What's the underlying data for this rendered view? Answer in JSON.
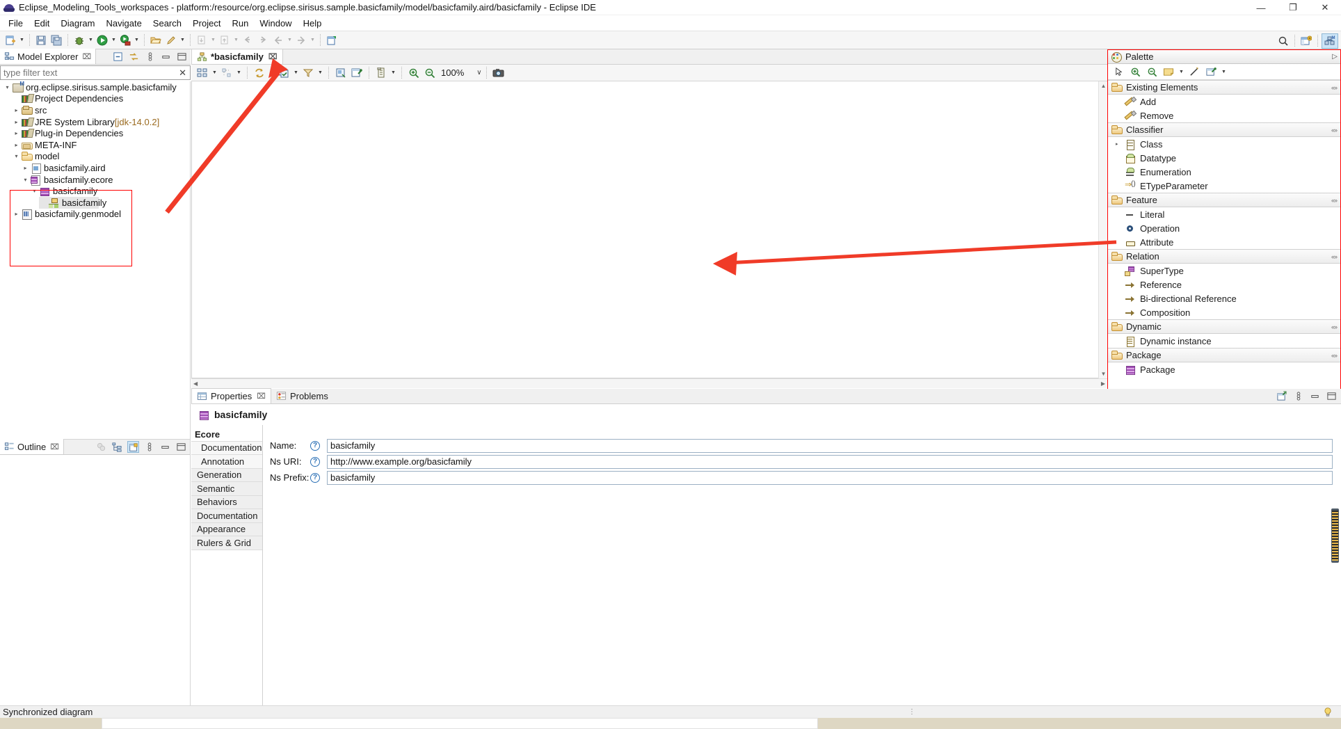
{
  "window": {
    "title": "Eclipse_Modeling_Tools_workspaces - platform:/resource/org.eclipse.sirisus.sample.basicfamily/model/basicfamily.aird/basicfamily - Eclipse IDE",
    "minimize_label": "—",
    "maximize_label": "❐",
    "close_label": "✕"
  },
  "menubar": {
    "items": [
      {
        "label": "File"
      },
      {
        "label": "Edit"
      },
      {
        "label": "Diagram"
      },
      {
        "label": "Navigate"
      },
      {
        "label": "Search"
      },
      {
        "label": "Project"
      },
      {
        "label": "Run"
      },
      {
        "label": "Window"
      },
      {
        "label": "Help"
      }
    ]
  },
  "model_explorer": {
    "tab_label": "Model Explorer",
    "close_glyph": "⌧",
    "filter_placeholder": "type filter text",
    "filter_value": "",
    "clear_glyph": "✕",
    "tools": [
      {
        "name": "collapse-all-icon"
      },
      {
        "name": "link-with-editor-icon"
      },
      {
        "name": "view-menu-icon"
      },
      {
        "name": "minimize-icon"
      },
      {
        "name": "maximize-icon"
      }
    ],
    "tree": [
      {
        "label": "org.eclipse.sirisus.sample.basicfamily",
        "indent": 0,
        "twist": "▾",
        "icon": "ic-proj",
        "selected": false,
        "dim": ""
      },
      {
        "label": "Project Dependencies",
        "indent": 1,
        "twist": "",
        "icon": "ic-lib",
        "selected": false,
        "dim": ""
      },
      {
        "label": "src",
        "indent": 1,
        "twist": "▸",
        "icon": "ic-pkgf",
        "selected": false,
        "dim": ""
      },
      {
        "label": "JRE System Library ",
        "indent": 1,
        "twist": "▸",
        "icon": "ic-lib",
        "selected": false,
        "dim": "[jdk-14.0.2]"
      },
      {
        "label": "Plug-in Dependencies",
        "indent": 1,
        "twist": "▸",
        "icon": "ic-lib",
        "selected": false,
        "dim": ""
      },
      {
        "label": "META-INF",
        "indent": 1,
        "twist": "▸",
        "icon": "ic-metainf",
        "selected": false,
        "dim": ""
      },
      {
        "label": "model",
        "indent": 1,
        "twist": "▾",
        "icon": "ic-folder",
        "selected": false,
        "dim": ""
      },
      {
        "label": "basicfamily.aird",
        "indent": 2,
        "twist": "▸",
        "icon": "ic-file",
        "selected": false,
        "dim": ""
      },
      {
        "label": "basicfamily.ecore",
        "indent": 2,
        "twist": "▾",
        "icon": "ic-ecore",
        "selected": false,
        "dim": ""
      },
      {
        "label": "basicfamily",
        "indent": 3,
        "twist": "▾",
        "icon": "ic-pkg",
        "selected": false,
        "dim": ""
      },
      {
        "label": "basicfamily",
        "indent": 4,
        "twist": "",
        "icon": "ic-diag",
        "selected": true,
        "dim": ""
      },
      {
        "label": "basicfamily.genmodel",
        "indent": 1,
        "twist": "▸",
        "icon": "ic-gen",
        "selected": false,
        "dim": ""
      }
    ]
  },
  "outline": {
    "tab_label": "Outline",
    "close_glyph": "⌧",
    "tools": [
      {
        "name": "hide-overlay-icon"
      },
      {
        "name": "tree-view-icon"
      },
      {
        "name": "layout-icon"
      },
      {
        "name": "view-menu-icon"
      },
      {
        "name": "minimize-icon"
      },
      {
        "name": "maximize-icon"
      }
    ]
  },
  "editor": {
    "tab_label": "*basicfamily",
    "close_glyph": "⌧",
    "zoom_value": "100%",
    "zoom_caret": "∨",
    "toolbar": [
      {
        "name": "arrange-all-icon"
      },
      {
        "name": "arrange-dropdown-icon"
      },
      {
        "name": "align-icon"
      },
      {
        "name": "align-dropdown-icon"
      },
      {
        "name": "refresh-diagram-icon"
      },
      {
        "name": "select-icon"
      },
      {
        "name": "select-dropdown-icon"
      },
      {
        "name": "filter-icon"
      },
      {
        "name": "filter-dropdown-icon"
      },
      {
        "name": "paste-format-icon"
      },
      {
        "name": "pin-icon"
      },
      {
        "name": "layers-icon"
      },
      {
        "name": "layers-dropdown-icon"
      },
      {
        "name": "zoom-in-icon"
      },
      {
        "name": "zoom-out-icon"
      },
      {
        "name": "screenshot-icon"
      }
    ]
  },
  "palette": {
    "title": "Palette",
    "pin_glyph": "▷",
    "tools": [
      {
        "name": "select-tool-icon"
      },
      {
        "name": "zoom-in-tool-icon"
      },
      {
        "name": "zoom-out-tool-icon"
      },
      {
        "name": "note-tool-icon"
      },
      {
        "name": "note-dropdown-icon"
      },
      {
        "name": "line-tool-icon"
      },
      {
        "name": "note-attachment-icon"
      },
      {
        "name": "note-attachment-dropdown-icon"
      }
    ],
    "collapse_glyph": "«»",
    "groups": [
      {
        "label": "Existing Elements",
        "entries": [
          {
            "label": "Add",
            "icon": "pi-pencil",
            "expand": ""
          },
          {
            "label": "Remove",
            "icon": "pi-pencil",
            "expand": ""
          }
        ]
      },
      {
        "label": "Classifier",
        "entries": [
          {
            "label": "Class",
            "icon": "pi-class",
            "expand": "▸"
          },
          {
            "label": "Datatype",
            "icon": "pi-dtype",
            "expand": ""
          },
          {
            "label": "Enumeration",
            "icon": "pi-enum",
            "expand": ""
          },
          {
            "label": "ETypeParameter",
            "icon": "pi-etp",
            "expand": ""
          }
        ]
      },
      {
        "label": "Feature",
        "entries": [
          {
            "label": "Literal",
            "icon": "pi-literal",
            "expand": ""
          },
          {
            "label": "Operation",
            "icon": "pi-oper",
            "expand": ""
          },
          {
            "label": "Attribute",
            "icon": "pi-attr",
            "expand": ""
          }
        ]
      },
      {
        "label": "Relation",
        "entries": [
          {
            "label": "SuperType",
            "icon": "pi-super",
            "expand": ""
          },
          {
            "label": "Reference",
            "icon": "pi-ref",
            "expand": ""
          },
          {
            "label": "Bi-directional Reference",
            "icon": "pi-ref",
            "expand": ""
          },
          {
            "label": "Composition",
            "icon": "pi-ref",
            "expand": ""
          }
        ]
      },
      {
        "label": "Dynamic",
        "entries": [
          {
            "label": "Dynamic instance",
            "icon": "pi-dyn",
            "expand": ""
          }
        ]
      },
      {
        "label": "Package",
        "entries": [
          {
            "label": "Package",
            "icon": "pi-pkg",
            "expand": ""
          }
        ]
      }
    ]
  },
  "properties": {
    "tabs": [
      {
        "label": "Properties",
        "active": true,
        "close_glyph": "⌧",
        "icon": "properties-icon"
      },
      {
        "label": "Problems",
        "active": false,
        "close_glyph": "",
        "icon": "problems-icon"
      }
    ],
    "title": "basicfamily",
    "side_tabs": [
      {
        "label": "Ecore",
        "selected": true,
        "indent": false
      },
      {
        "label": "Documentation",
        "selected": false,
        "indent": true
      },
      {
        "label": "Annotation",
        "selected": false,
        "indent": true
      },
      {
        "label": "Generation",
        "selected": false,
        "indent": false
      },
      {
        "label": "Semantic",
        "selected": false,
        "indent": false
      },
      {
        "label": "Behaviors",
        "selected": false,
        "indent": false
      },
      {
        "label": "Documentation",
        "selected": false,
        "indent": false
      },
      {
        "label": "Appearance",
        "selected": false,
        "indent": false
      },
      {
        "label": "Rulers & Grid",
        "selected": false,
        "indent": false
      }
    ],
    "help_glyph": "?",
    "fields": [
      {
        "label": "Name:",
        "value": "basicfamily"
      },
      {
        "label": "Ns URI:",
        "value": "http://www.example.org/basicfamily"
      },
      {
        "label": "Ns Prefix:",
        "value": "basicfamily"
      }
    ],
    "tools": [
      {
        "name": "restore-icon"
      },
      {
        "name": "view-menu-icon"
      },
      {
        "name": "minimize-icon"
      },
      {
        "name": "maximize-icon"
      }
    ]
  },
  "statusbar": {
    "message": "Synchronized diagram",
    "dots_glyph": "⋮",
    "bulb_icon": "tip-bulb-icon"
  },
  "toolbar_main": {
    "groups": [
      {
        "buttons": [
          {
            "name": "new-wizard-icon",
            "arrow": true
          }
        ]
      },
      {
        "buttons": [
          {
            "name": "save-icon",
            "arrow": false
          },
          {
            "name": "save-all-icon",
            "arrow": false
          }
        ]
      },
      {
        "buttons": [
          {
            "name": "debug-icon",
            "arrow": true
          },
          {
            "name": "run-icon",
            "arrow": true
          },
          {
            "name": "coverage-icon",
            "arrow": true
          }
        ]
      },
      {
        "buttons": [
          {
            "name": "open-type-icon",
            "arrow": false
          },
          {
            "name": "quick-fix-icon",
            "arrow": true
          }
        ]
      },
      {
        "buttons": [
          {
            "name": "next-annotation-icon",
            "arrow": true
          },
          {
            "name": "previous-annotation-icon",
            "arrow": true
          },
          {
            "name": "back-history-icon",
            "arrow": false
          },
          {
            "name": "forward-history-icon",
            "arrow": false
          },
          {
            "name": "back-icon",
            "arrow": true
          },
          {
            "name": "forward-icon",
            "arrow": true
          }
        ]
      },
      {
        "buttons": [
          {
            "name": "new-diagram-icon",
            "arrow": false
          }
        ]
      }
    ],
    "right": [
      {
        "name": "search-icon"
      },
      {
        "name": "open-perspective-icon"
      },
      {
        "name": "modeling-perspective-icon"
      }
    ]
  },
  "colors": {
    "annotation_red": "#ff0000",
    "selection_gray": "#e6e6e6",
    "link_brown": "#9a6a1f",
    "accent_blue": "#2a6fb5"
  }
}
